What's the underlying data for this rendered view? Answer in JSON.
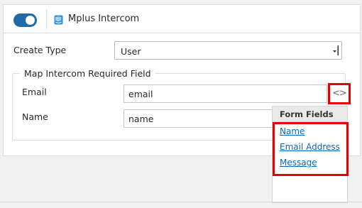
{
  "header": {
    "toggle": {
      "state": "on",
      "color": "#1e6ba8"
    },
    "icon": "intercom-icon",
    "title": "Mplus Intercom"
  },
  "create_type": {
    "label": "Create Type",
    "selected": "User"
  },
  "mapping": {
    "legend": "Map Intercom Required Field",
    "email": {
      "label": "Email",
      "value": "email"
    },
    "name": {
      "label": "Name",
      "value": "name"
    },
    "code_button_icon": "code-icon"
  },
  "form_fields_popup": {
    "title": "Form Fields",
    "items": [
      "Name",
      "Email Address",
      "Message"
    ]
  },
  "colors": {
    "highlight": "#e60000",
    "link": "#0a66b7"
  }
}
